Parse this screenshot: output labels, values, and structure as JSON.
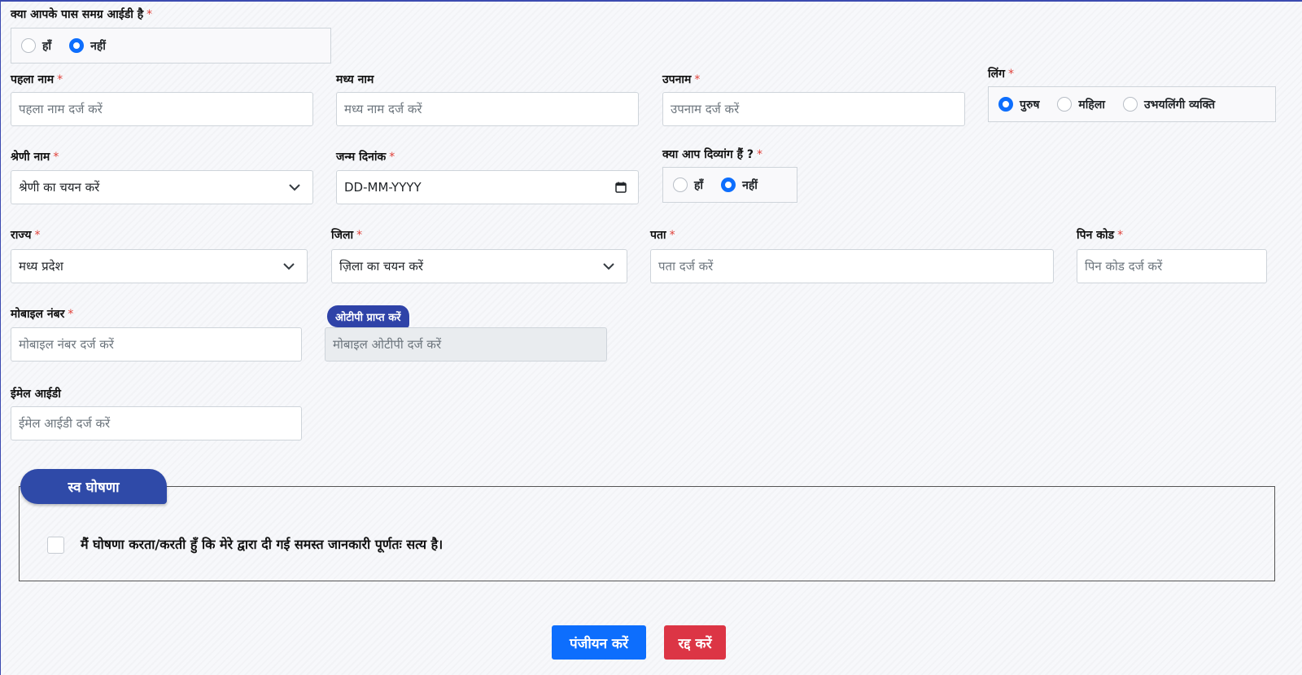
{
  "samagra": {
    "question": "क्या आपके पास समग्र आईडी है",
    "options": [
      "हाँ",
      "नहीं"
    ],
    "selected": 1
  },
  "first_name": {
    "label": "पहला नाम",
    "placeholder": "पहला नाम दर्ज करें"
  },
  "middle_name": {
    "label": "मध्य नाम",
    "placeholder": "मध्य नाम दर्ज करें"
  },
  "surname": {
    "label": "उपनाम",
    "placeholder": "उपनाम दर्ज करें"
  },
  "gender": {
    "label": "लिंग",
    "options": [
      "पुरुष",
      "महिला",
      "उभयलिंगी व्यक्ति"
    ],
    "selected": 0
  },
  "category": {
    "label": "श्रेणी नाम",
    "value": "श्रेणी का चयन करें"
  },
  "dob": {
    "label": "जन्म दिनांक",
    "value": "DD-MM-YYYY"
  },
  "disabled_q": {
    "label": "क्या आप दिव्यांग हैं ?",
    "options": [
      "हाँ",
      "नहीं"
    ],
    "selected": 1
  },
  "state": {
    "label": "राज्य",
    "value": "मध्य प्रदेश"
  },
  "district": {
    "label": "जिला",
    "value": "ज़िला का चयन करें"
  },
  "address": {
    "label": "पता",
    "placeholder": "पता दर्ज करें"
  },
  "pincode": {
    "label": "पिन कोड",
    "placeholder": "पिन कोड दर्ज करें"
  },
  "mobile": {
    "label": "मोबाइल नंबर",
    "placeholder": "मोबाइल नंबर दर्ज करें"
  },
  "otp": {
    "button": "ओटीपी प्राप्त करें",
    "placeholder": "मोबाइल ओटीपी दर्ज करें"
  },
  "email": {
    "label": "ईमेल आईडी",
    "placeholder": "ईमेल आईडी दर्ज करें"
  },
  "declaration": {
    "title": "स्व घोषणा",
    "text": "मैं घोषणा करता/करती हुँ कि मेरे द्वारा दी गई समस्त जानकारी पूर्णतः सत्य है।",
    "checked": false
  },
  "actions": {
    "register": "पंजीयन करें",
    "cancel": "रद्द करें"
  },
  "required_mark": "*",
  "colors": {
    "primary": "#0d6efd",
    "danger": "#dc3545",
    "accent": "#2f4aa8",
    "required": "#e0413a"
  }
}
